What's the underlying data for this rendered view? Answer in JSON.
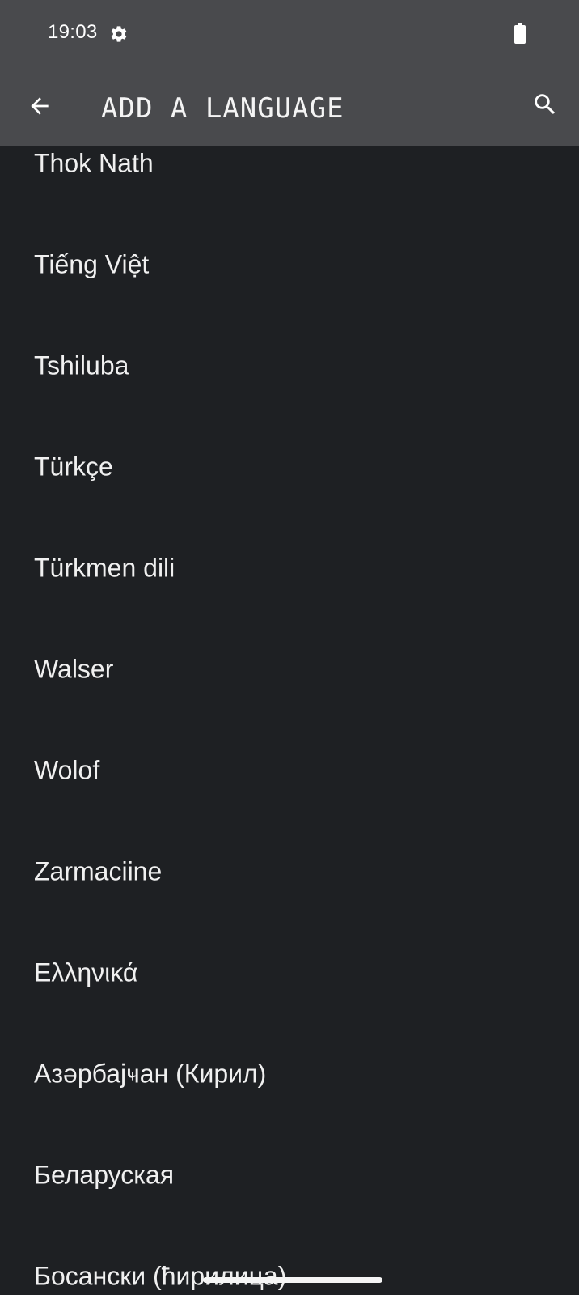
{
  "status_bar": {
    "time": "19:03",
    "settings_icon": "gear-icon",
    "battery_icon": "battery-icon"
  },
  "app_bar": {
    "title": "ADD A LANGUAGE",
    "back_icon": "arrow-back-icon",
    "search_icon": "search-icon"
  },
  "languages": [
    "Thok Nath",
    "Tiếng Việt",
    "Tshiluba",
    "Türkçe",
    "Türkmen dili",
    "Walser",
    "Wolof",
    "Zarmaciine",
    "Ελληνικά",
    "Азәрбајҹан (Кирил)",
    "Беларуская",
    "Босански (ћирилица)"
  ],
  "colors": {
    "bar_background": "#494a4d",
    "list_background": "#1e2023",
    "text": "#f0f0f0"
  }
}
